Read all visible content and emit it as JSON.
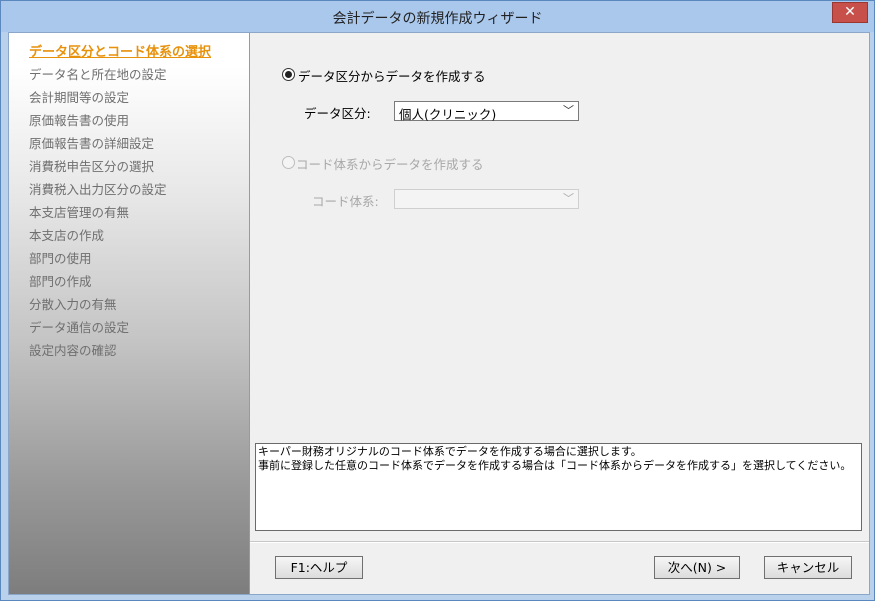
{
  "window": {
    "title": "会計データの新規作成ウィザード",
    "close_glyph": "✕"
  },
  "sidebar": {
    "steps": [
      {
        "label": "データ区分とコード体系の選択",
        "active": true
      },
      {
        "label": "データ名と所在地の設定"
      },
      {
        "label": "会計期間等の設定"
      },
      {
        "label": "原価報告書の使用"
      },
      {
        "label": "原価報告書の詳細設定"
      },
      {
        "label": "消費税申告区分の選択"
      },
      {
        "label": "消費税入出力区分の設定"
      },
      {
        "label": "本支店管理の有無"
      },
      {
        "label": "本支店の作成"
      },
      {
        "label": "部門の使用"
      },
      {
        "label": "部門の作成"
      },
      {
        "label": "分散入力の有無"
      },
      {
        "label": "データ通信の設定"
      },
      {
        "label": "設定内容の確認"
      }
    ]
  },
  "main": {
    "option1": {
      "label": "データ区分からデータを作成する",
      "selected": true
    },
    "data_kubun": {
      "label": "データ区分:",
      "value": "個人(クリニック)"
    },
    "option2": {
      "label": "コード体系からデータを作成する",
      "selected": false,
      "disabled": true
    },
    "code_taikei": {
      "label": "コード体系:",
      "value": ""
    },
    "description": {
      "line1": "キーパー財務オリジナルのコード体系でデータを作成する場合に選択します。",
      "line2": "事前に登録した任意のコード体系でデータを作成する場合は「コード体系からデータを作成する」を選択してください。"
    }
  },
  "buttons": {
    "help": "F1:ヘルプ",
    "next": "次へ(N) >",
    "cancel": "キャンセル"
  },
  "icons": {
    "dropdown": "chevron-down-icon",
    "close": "close-icon"
  },
  "colors": {
    "active_step": "#e8910b",
    "titlebar": "#aac8ec",
    "close": "#c7504a"
  }
}
